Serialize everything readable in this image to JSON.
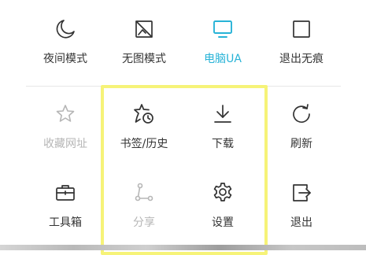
{
  "menu": {
    "items": [
      {
        "label": "夜间模式",
        "icon": "moon-icon",
        "state": "normal"
      },
      {
        "label": "无图模式",
        "icon": "no-image-icon",
        "state": "normal"
      },
      {
        "label": "电脑UA",
        "icon": "monitor-icon",
        "state": "active"
      },
      {
        "label": "退出无痕",
        "icon": "square-icon",
        "state": "normal"
      },
      {
        "label": "收藏网址",
        "icon": "star-icon",
        "state": "disabled"
      },
      {
        "label": "书签/历史",
        "icon": "star-clock-icon",
        "state": "normal"
      },
      {
        "label": "下载",
        "icon": "download-icon",
        "state": "normal"
      },
      {
        "label": "刷新",
        "icon": "refresh-icon",
        "state": "normal"
      },
      {
        "label": "工具箱",
        "icon": "toolbox-icon",
        "state": "normal"
      },
      {
        "label": "分享",
        "icon": "share-icon",
        "state": "disabled"
      },
      {
        "label": "设置",
        "icon": "gear-icon",
        "state": "normal"
      },
      {
        "label": "退出",
        "icon": "exit-icon",
        "state": "normal"
      }
    ]
  },
  "colors": {
    "active": "#27b3d7",
    "text": "#333333",
    "disabled": "#b6b6b6",
    "highlight": "#f6f378"
  }
}
